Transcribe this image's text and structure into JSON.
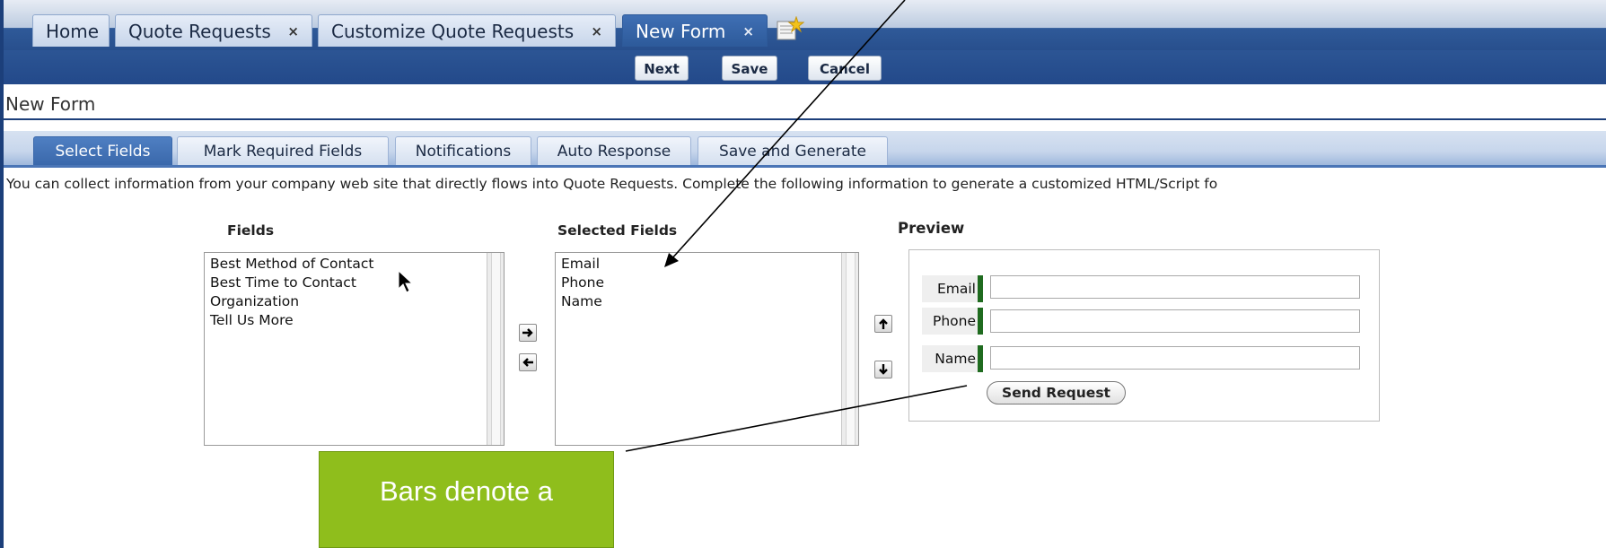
{
  "top_tabs": [
    {
      "label": "Home",
      "closable": false
    },
    {
      "label": "Quote Requests",
      "closable": true
    },
    {
      "label": "Customize Quote Requests",
      "closable": true
    },
    {
      "label": "New Form",
      "closable": true,
      "active": true
    }
  ],
  "close_glyph": "×",
  "new_tab_icon": "add-tab-icon",
  "actions": {
    "next": "Next",
    "save": "Save",
    "cancel": "Cancel"
  },
  "page_title": "New Form",
  "sub_tabs": [
    {
      "label": "Select Fields",
      "active": true
    },
    {
      "label": "Mark Required Fields"
    },
    {
      "label": "Notifications"
    },
    {
      "label": "Auto Response"
    },
    {
      "label": "Save and Generate"
    }
  ],
  "intro": "You can collect information from your company web site that directly flows into Quote Requests. Complete the following information to generate a customized HTML/Script fo",
  "fields": {
    "heading": "Fields",
    "items": [
      "Best Method of Contact",
      "Best Time to Contact",
      "Organization",
      "Tell Us More"
    ]
  },
  "selected_fields": {
    "heading": "Selected Fields",
    "items": [
      "Email",
      "Phone",
      "Name"
    ]
  },
  "transfer": {
    "add_glyph": "🡒",
    "remove_glyph": "🡐",
    "up_glyph": "🡑",
    "down_glyph": "🡓"
  },
  "preview": {
    "heading": "Preview",
    "fields": [
      "Email",
      "Phone",
      "Name"
    ],
    "submit_label": "Send Request"
  },
  "callout": "Bars denote a",
  "colors": {
    "tab_blue": "#2d5a9a",
    "required_bar": "#1f6b1f",
    "callout_green": "#8fbe1c"
  }
}
